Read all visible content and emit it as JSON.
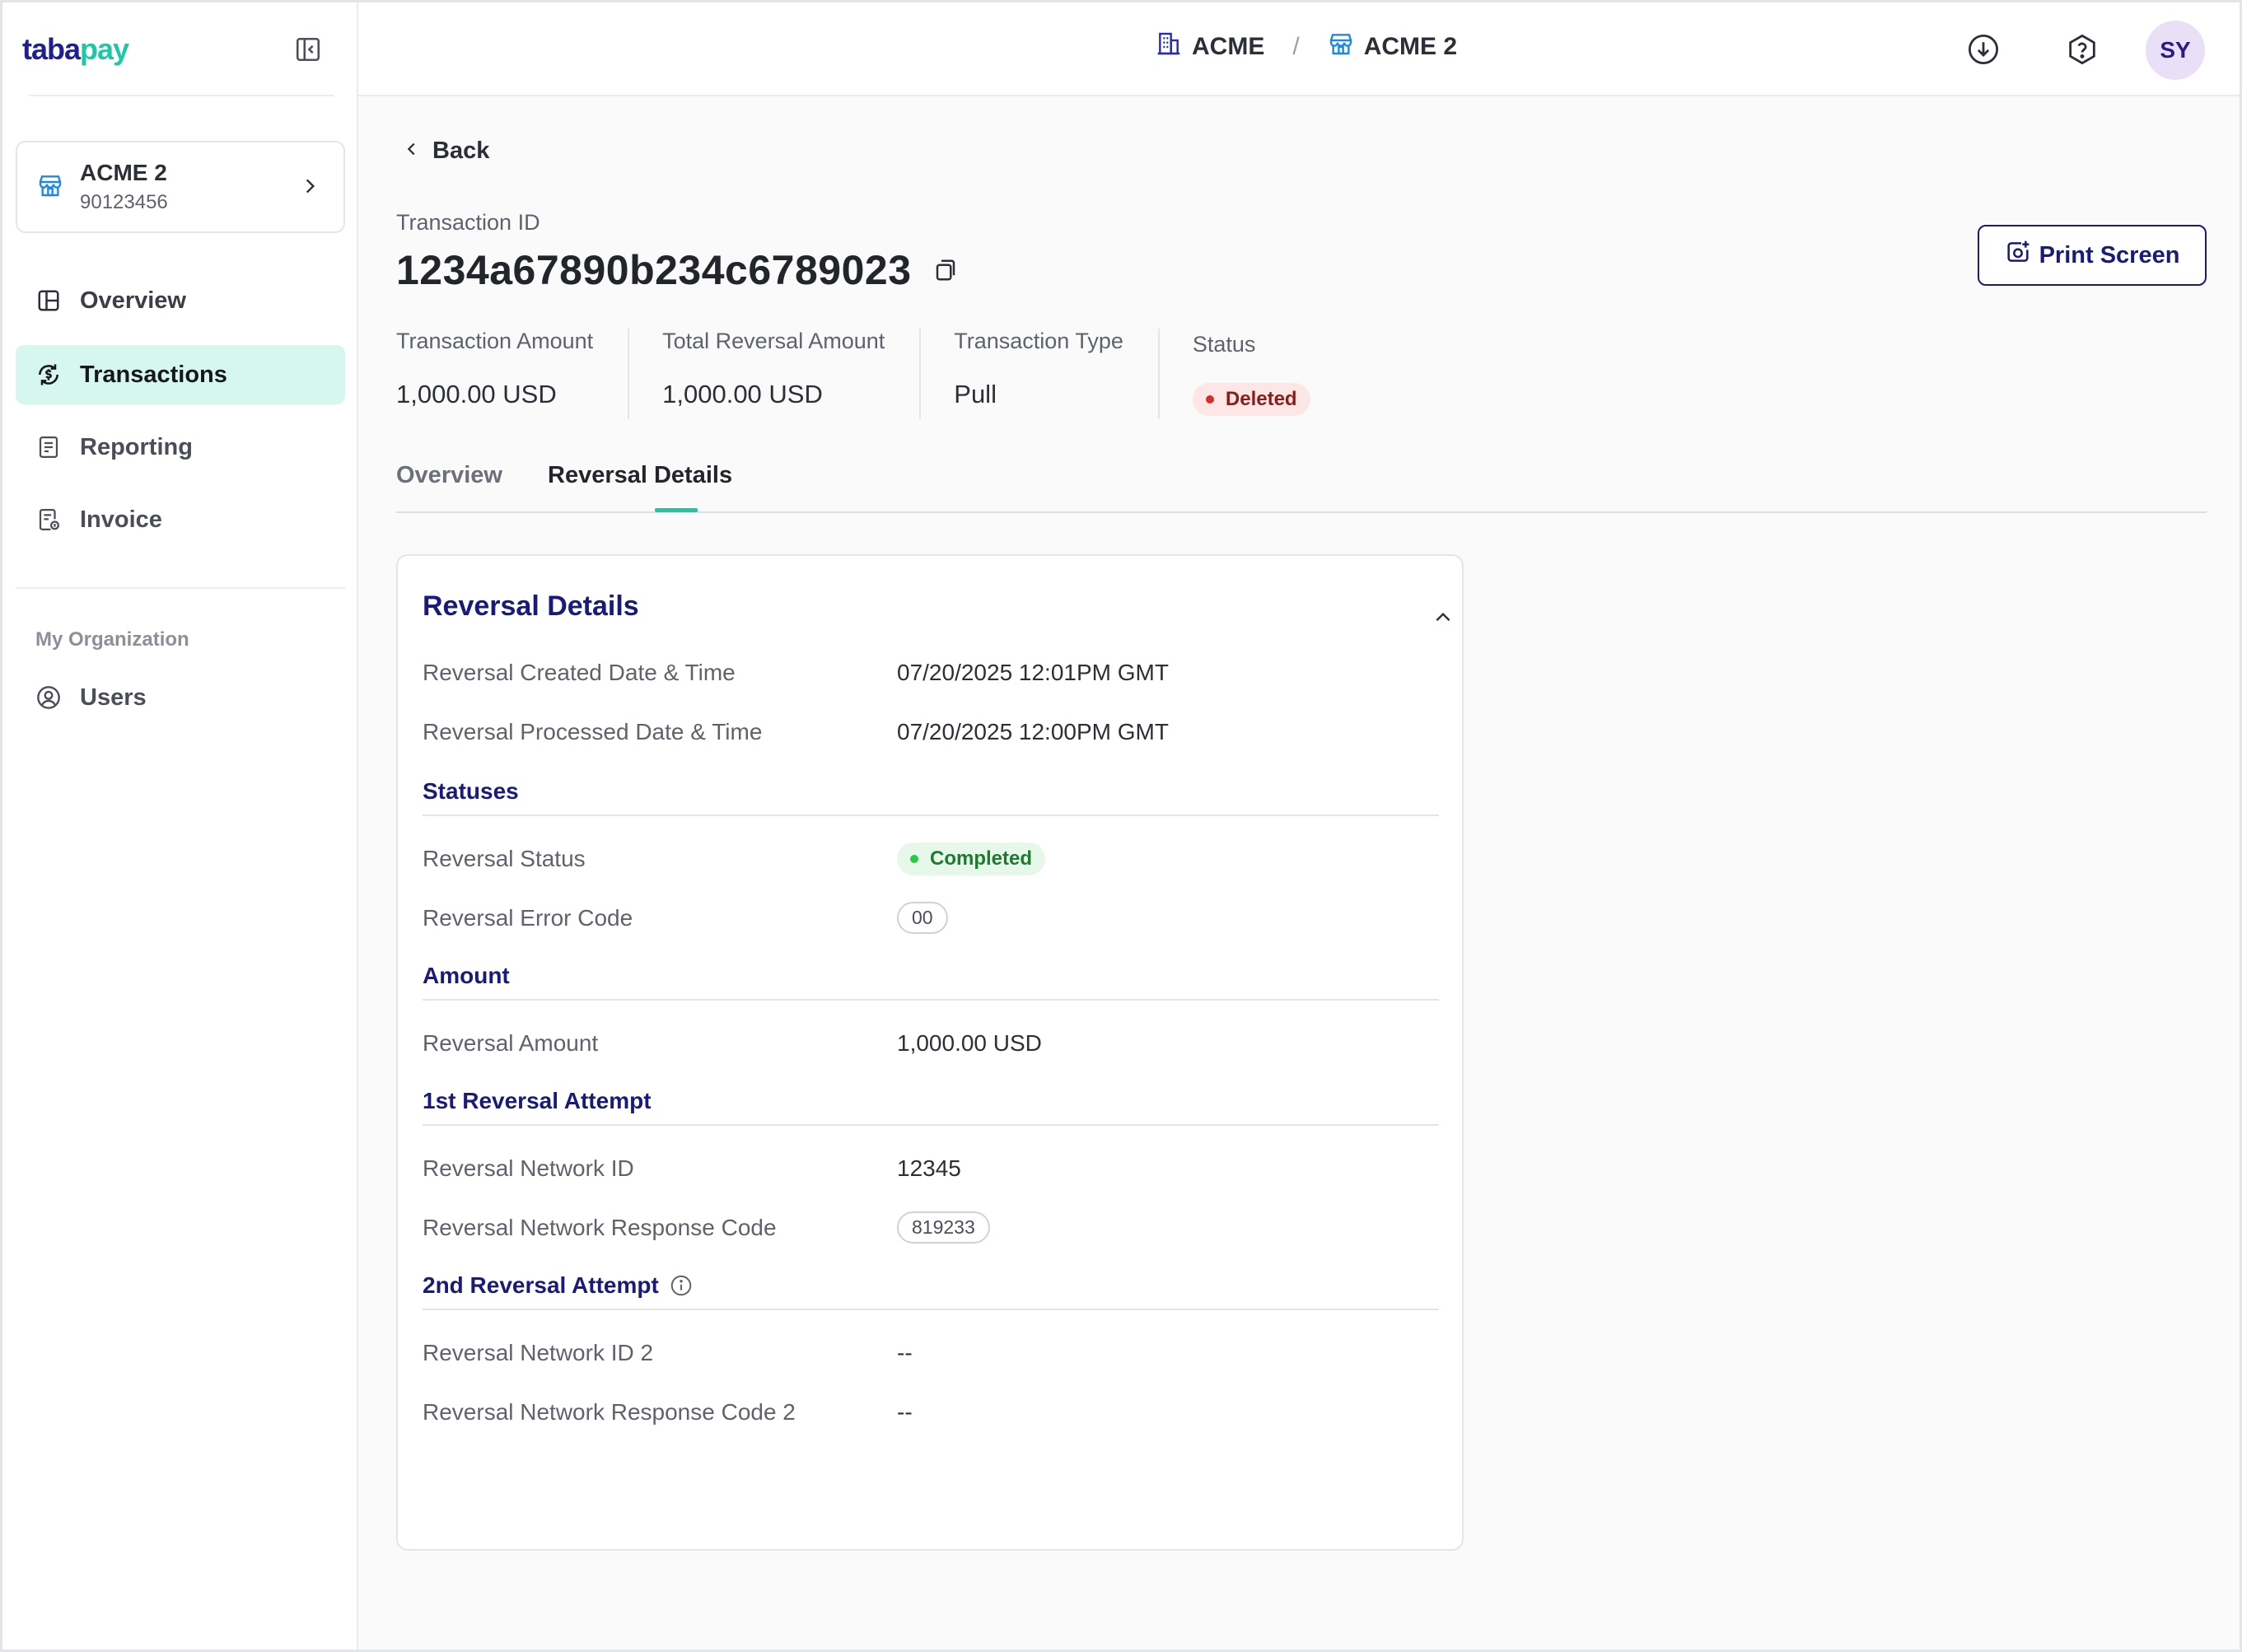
{
  "brand": {
    "logo_part1": "taba",
    "logo_part2": "pay"
  },
  "sidebar": {
    "merchant": {
      "name": "ACME 2",
      "id": "90123456"
    },
    "nav": [
      {
        "label": "Overview",
        "icon": "layout-icon"
      },
      {
        "label": "Transactions",
        "icon": "transactions-icon",
        "active": true
      },
      {
        "label": "Reporting",
        "icon": "report-icon"
      },
      {
        "label": "Invoice",
        "icon": "invoice-icon"
      }
    ],
    "section_label": "My Organization",
    "org_nav": [
      {
        "label": "Users",
        "icon": "user-icon"
      }
    ]
  },
  "header": {
    "breadcrumb": [
      {
        "label": "ACME",
        "icon": "building-icon"
      },
      {
        "label": "ACME 2",
        "icon": "store-icon"
      }
    ],
    "separator": "/",
    "avatar_initials": "SY"
  },
  "page": {
    "back_label": "Back",
    "transaction_id_label": "Transaction ID",
    "transaction_id": "1234a67890b234c6789023",
    "print_button": "Print Screen",
    "summary": [
      {
        "label": "Transaction Amount",
        "value": "1,000.00 USD"
      },
      {
        "label": "Total Reversal Amount",
        "value": "1,000.00 USD"
      },
      {
        "label": "Transaction Type",
        "value": "Pull"
      }
    ],
    "status": {
      "label": "Status",
      "value": "Deleted"
    },
    "tabs": [
      {
        "label": "Overview"
      },
      {
        "label": "Reversal Details",
        "active": true
      }
    ]
  },
  "reversal": {
    "title": "Reversal Details",
    "created_label": "Reversal Created Date & Time",
    "created_value": "07/20/2025 12:01PM GMT",
    "processed_label": "Reversal Processed Date & Time",
    "processed_value": "07/20/2025 12:00PM GMT",
    "statuses_title": "Statuses",
    "status_label": "Reversal Status",
    "status_value": "Completed",
    "error_code_label": "Reversal Error Code",
    "error_code_value": "00",
    "amount_title": "Amount",
    "amount_label": "Reversal Amount",
    "amount_value": "1,000.00 USD",
    "attempt1_title": "1st Reversal Attempt",
    "network_id_label": "Reversal Network ID",
    "network_id_value": "12345",
    "response_code_label": "Reversal Network Response Code",
    "response_code_value": "819233",
    "attempt2_title": "2nd Reversal Attempt",
    "network_id2_label": "Reversal Network ID 2",
    "network_id2_value": "--",
    "response_code2_label": "Reversal Network Response Code 2",
    "response_code2_value": "--"
  },
  "colors": {
    "accent": "#1fc8a5",
    "navy": "#1a1a7a",
    "active_nav_bg": "#d6f7ee",
    "danger": "#d32f2f",
    "success": "#28c840"
  }
}
